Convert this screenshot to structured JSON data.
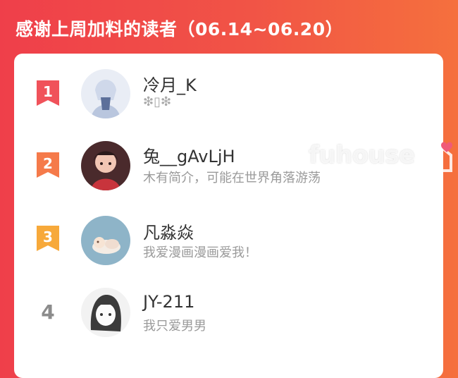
{
  "header": {
    "title": "感谢上周加料的读者（06.14~06.20）"
  },
  "readers": [
    {
      "rank": "1",
      "name": "冷月_K",
      "bio": "❇▯❇",
      "badge_color": "#f0525a"
    },
    {
      "rank": "2",
      "name": "兔__gAvLjH",
      "bio": "木有简介，可能在世界角落游荡",
      "badge_color": "#f57a4a"
    },
    {
      "rank": "3",
      "name": "凡淼焱",
      "bio": "我爱漫画漫画爱我！",
      "badge_color": "#f7a93a"
    },
    {
      "rank": "4",
      "name": "JY-211",
      "bio": "我只爱男男",
      "badge_color": "#8c8c8c"
    }
  ],
  "watermark": {
    "text": "fuhouse",
    "icon": "heart-house-logo"
  }
}
